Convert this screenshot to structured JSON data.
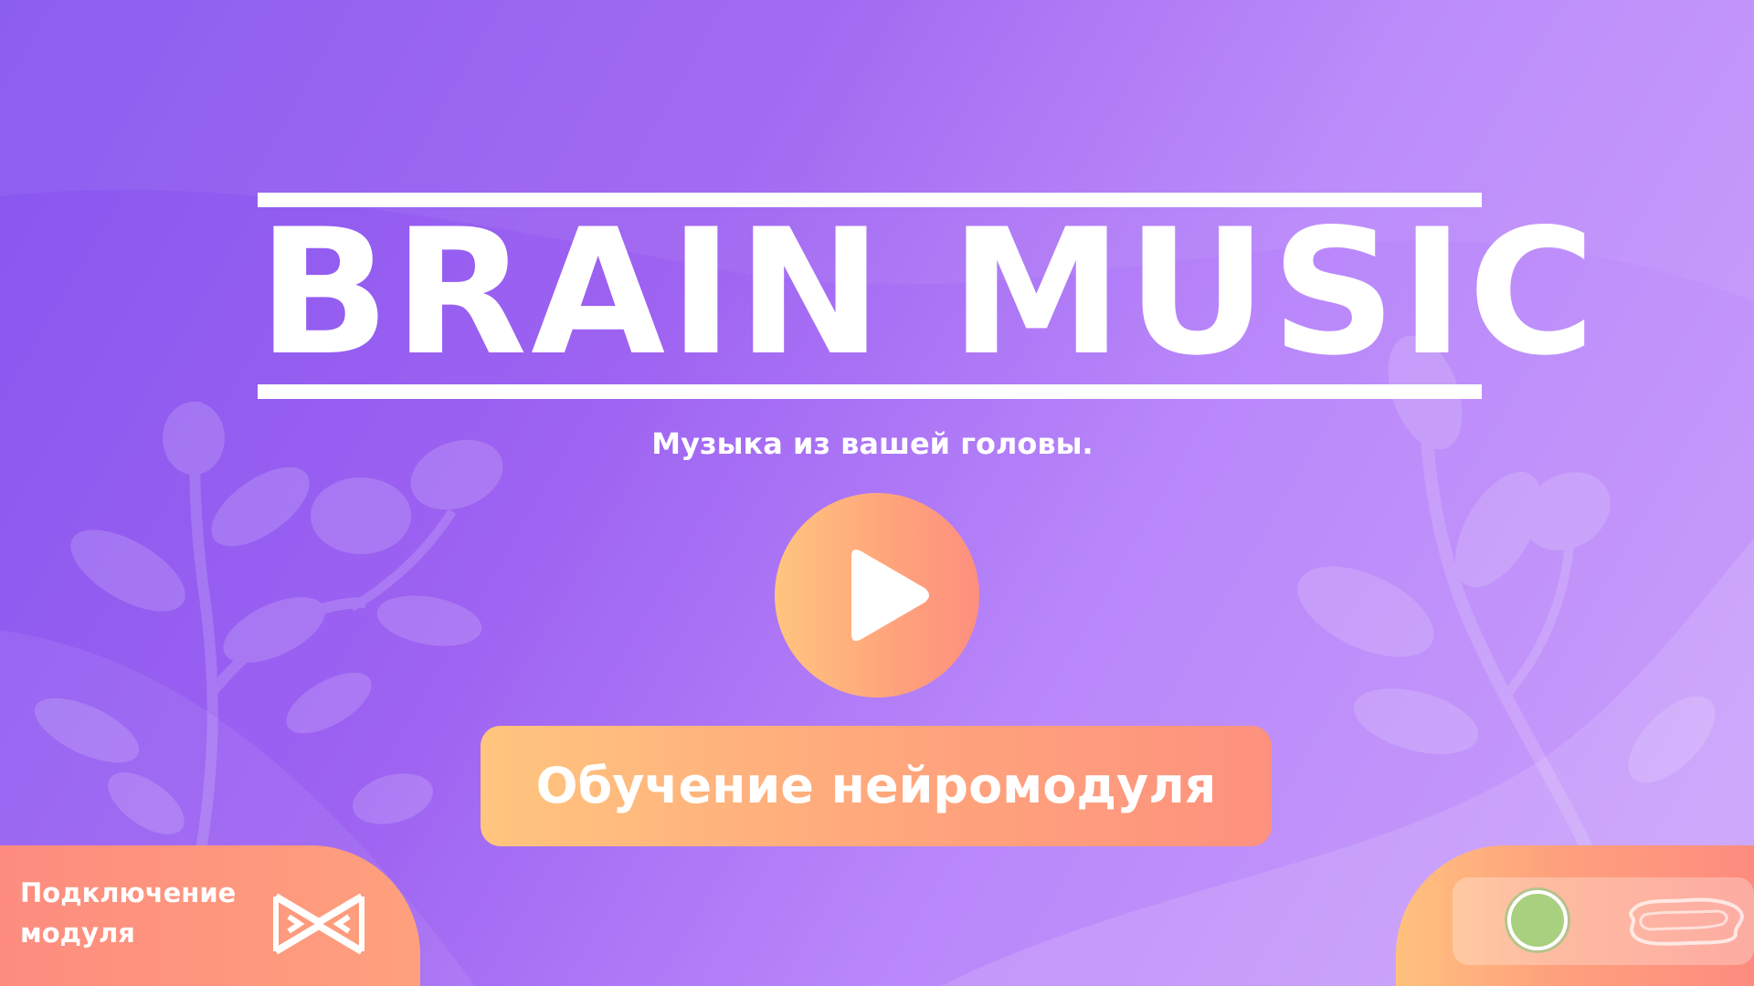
{
  "app": {
    "title": "BRAIN MUSIC",
    "tagline": "Музыка из вашей головы."
  },
  "main": {
    "play_icon": "play-icon",
    "train_button_label": "Обучение нейромодуля"
  },
  "footer": {
    "connect": {
      "label_line1": "Подключение",
      "label_line2": "модуля",
      "icon": "module-connection-icon"
    },
    "status": {
      "indicator_color": "#a8d07e",
      "indicator_state": "connected",
      "icon": "brain-signal-icon"
    }
  },
  "colors": {
    "background_start": "#8656f0",
    "background_end": "#c9a0fb",
    "accent_orange": "#fea07d",
    "accent_yellow": "#ffc57e",
    "text": "#ffffff"
  }
}
